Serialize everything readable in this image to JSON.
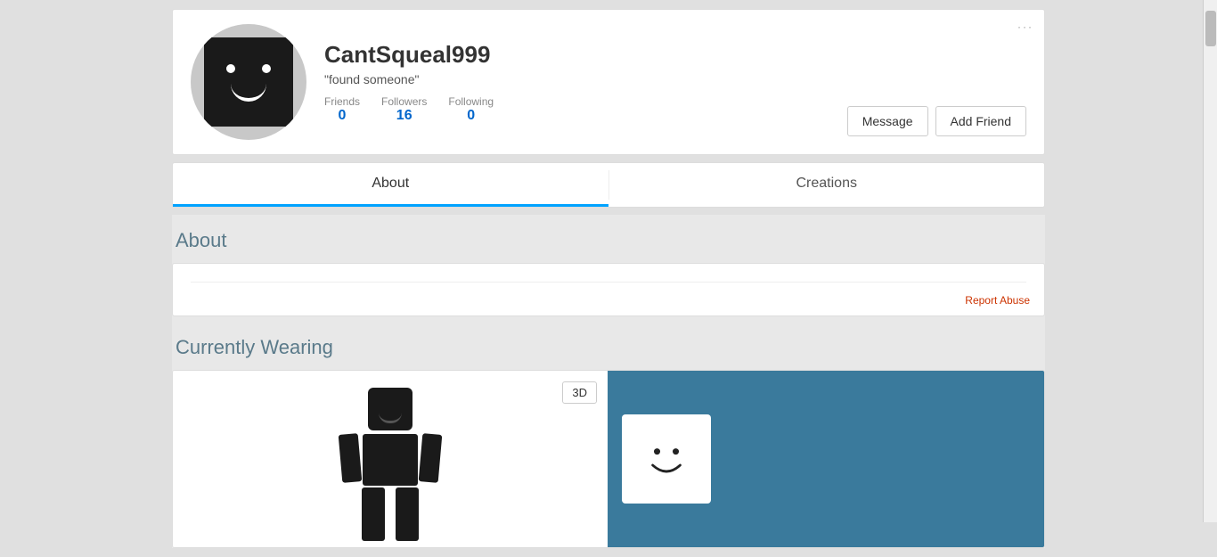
{
  "profile": {
    "username": "CantSqueal999",
    "status": "\"found someone\"",
    "friends_label": "Friends",
    "followers_label": "Followers",
    "following_label": "Following",
    "friends_count": "0",
    "followers_count": "16",
    "following_count": "0",
    "message_button": "Message",
    "add_friend_button": "Add Friend",
    "more_options": "···"
  },
  "tabs": {
    "about_label": "About",
    "creations_label": "Creations"
  },
  "about": {
    "heading": "About",
    "report_abuse": "Report Abuse"
  },
  "currently_wearing": {
    "heading": "Currently Wearing",
    "btn_3d": "3D"
  }
}
